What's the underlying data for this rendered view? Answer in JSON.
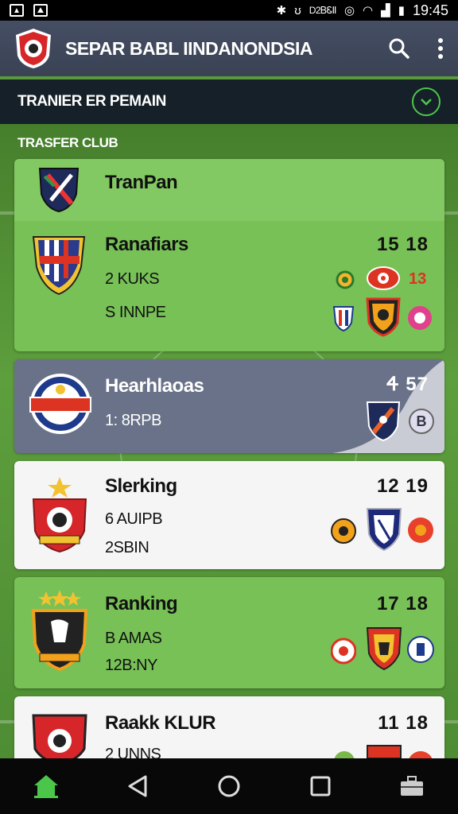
{
  "status_bar": {
    "carrier": "D2ᏴᏋⅡ",
    "time": "19:45"
  },
  "app": {
    "title": "SEPAR BABL IINDANONDSIA"
  },
  "section": {
    "title": "TRANIER ER PEMAIN",
    "sub_label": "TRASFER CLUB"
  },
  "cards": [
    {
      "name": "TranPan",
      "lines": [],
      "score": ""
    },
    {
      "name": "Ranafiars",
      "lines": [
        "2 KUKS",
        "S INNPE"
      ],
      "score": "15  18",
      "mini_badge_text": "13"
    },
    {
      "name": "Hearhlaoas",
      "lines": [
        "1: 8RPB"
      ],
      "score": "Ꮞ  57",
      "mini_badge_text": "B"
    },
    {
      "name": "Slerking",
      "lines": [
        "6 AUIPB",
        "2SBIN"
      ],
      "score": "12  19"
    },
    {
      "name": "Ranking",
      "lines": [
        "B AMAS",
        "12B:NY"
      ],
      "score": "17  18"
    },
    {
      "name": "Raakk KLUR",
      "lines": [
        "2 UNNS"
      ],
      "score": "11  18"
    }
  ],
  "colors": {
    "app_bar": "#3f4759",
    "section_header": "#162028",
    "accent_green": "#4cc64a",
    "card_green": "#78c157"
  }
}
